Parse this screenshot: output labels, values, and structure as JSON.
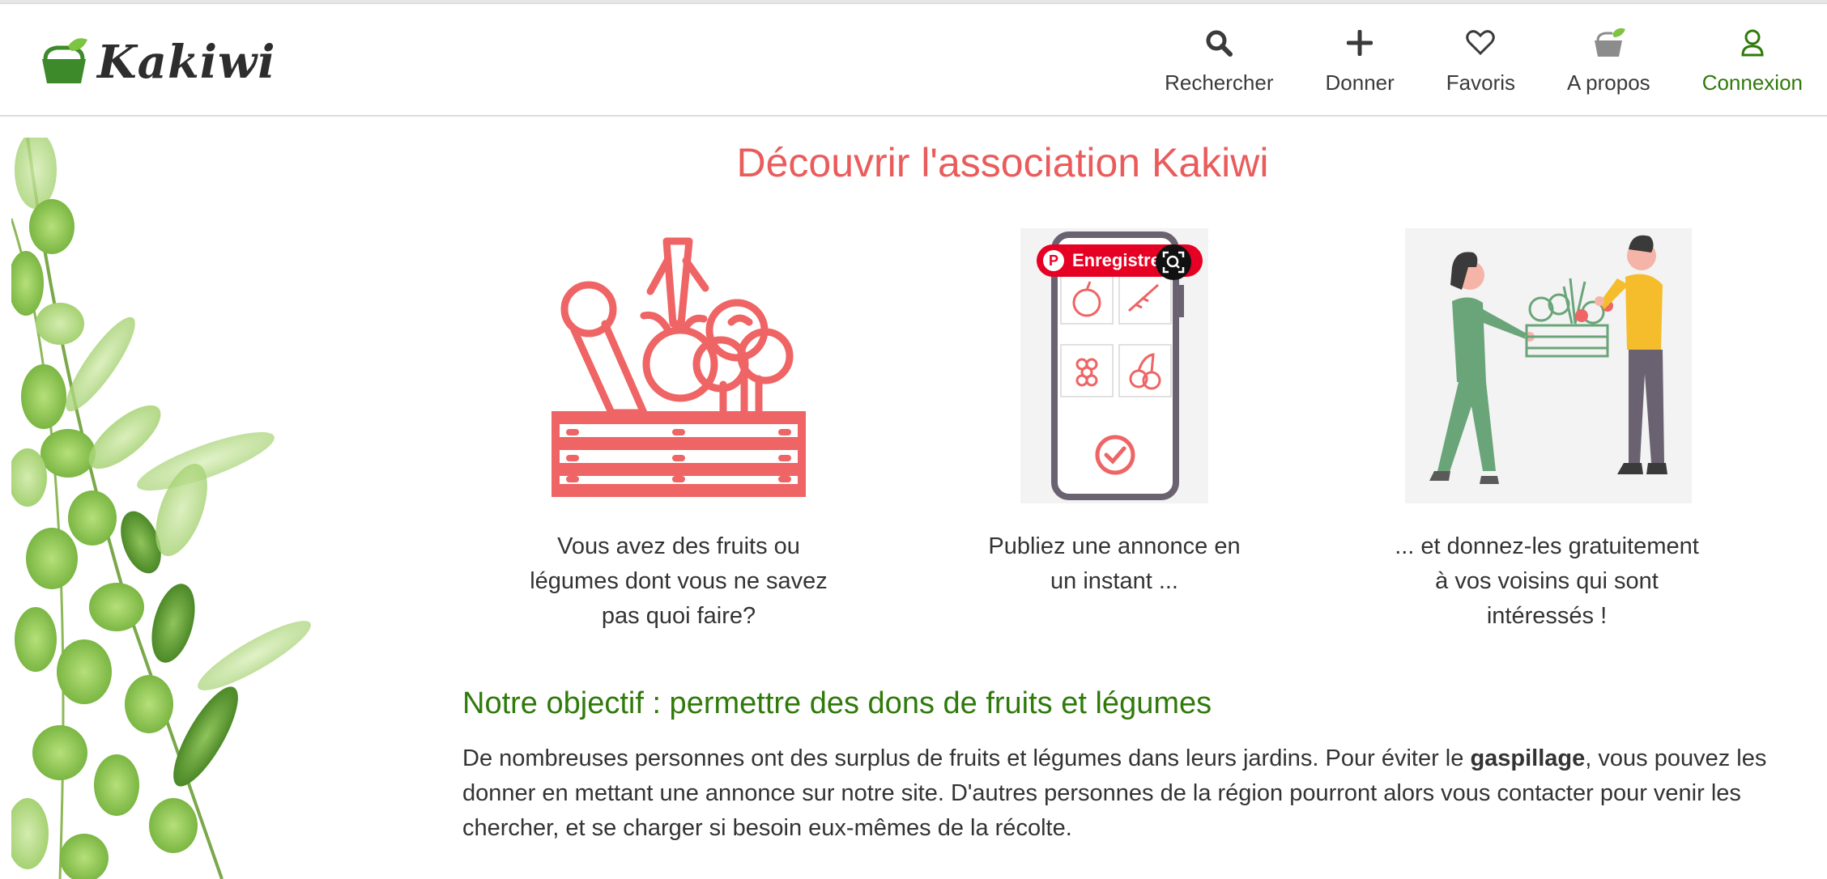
{
  "header": {
    "logo_text": "Kakiwi",
    "nav": [
      {
        "label": "Rechercher",
        "icon": "search-icon"
      },
      {
        "label": "Donner",
        "icon": "plus-icon"
      },
      {
        "label": "Favoris",
        "icon": "heart-icon"
      },
      {
        "label": "A propos",
        "icon": "basket-icon"
      },
      {
        "label": "Connexion",
        "icon": "user-icon"
      }
    ]
  },
  "main": {
    "title": "Découvrir l'association Kakiwi",
    "steps": [
      {
        "caption_lines": [
          "Vous avez des fruits ou",
          "légumes dont vous ne savez",
          "pas quoi faire?"
        ],
        "image": "vegetable-crate-illustration"
      },
      {
        "caption_lines": [
          "Publiez une annonce en",
          "un instant ..."
        ],
        "image": "phone-app-illustration"
      },
      {
        "caption_lines": [
          "... et donnez-les gratuitement",
          "à vos voisins qui sont",
          "intéressés !"
        ],
        "image": "people-exchange-illustration"
      }
    ],
    "pinterest_label": "Enregistre",
    "objective_title": "Notre objectif : permettre des dons de fruits et légumes",
    "paragraph": {
      "part1": "De nombreuses personnes ont des surplus de fruits et légumes dans leurs jardins. Pour éviter le ",
      "bold": "gaspillage",
      "part2": ", vous pouvez les donner en mettant une annonce sur notre site. D'autres personnes de la région pourront alors vous contacter pour venir les chercher, et se charger si besoin eux-mêmes de la récolte."
    }
  },
  "colors": {
    "accent_red": "#ea5c5c",
    "brand_green": "#2f7a0a",
    "illustration_red": "#ef6464",
    "pinterest": "#e60023"
  }
}
